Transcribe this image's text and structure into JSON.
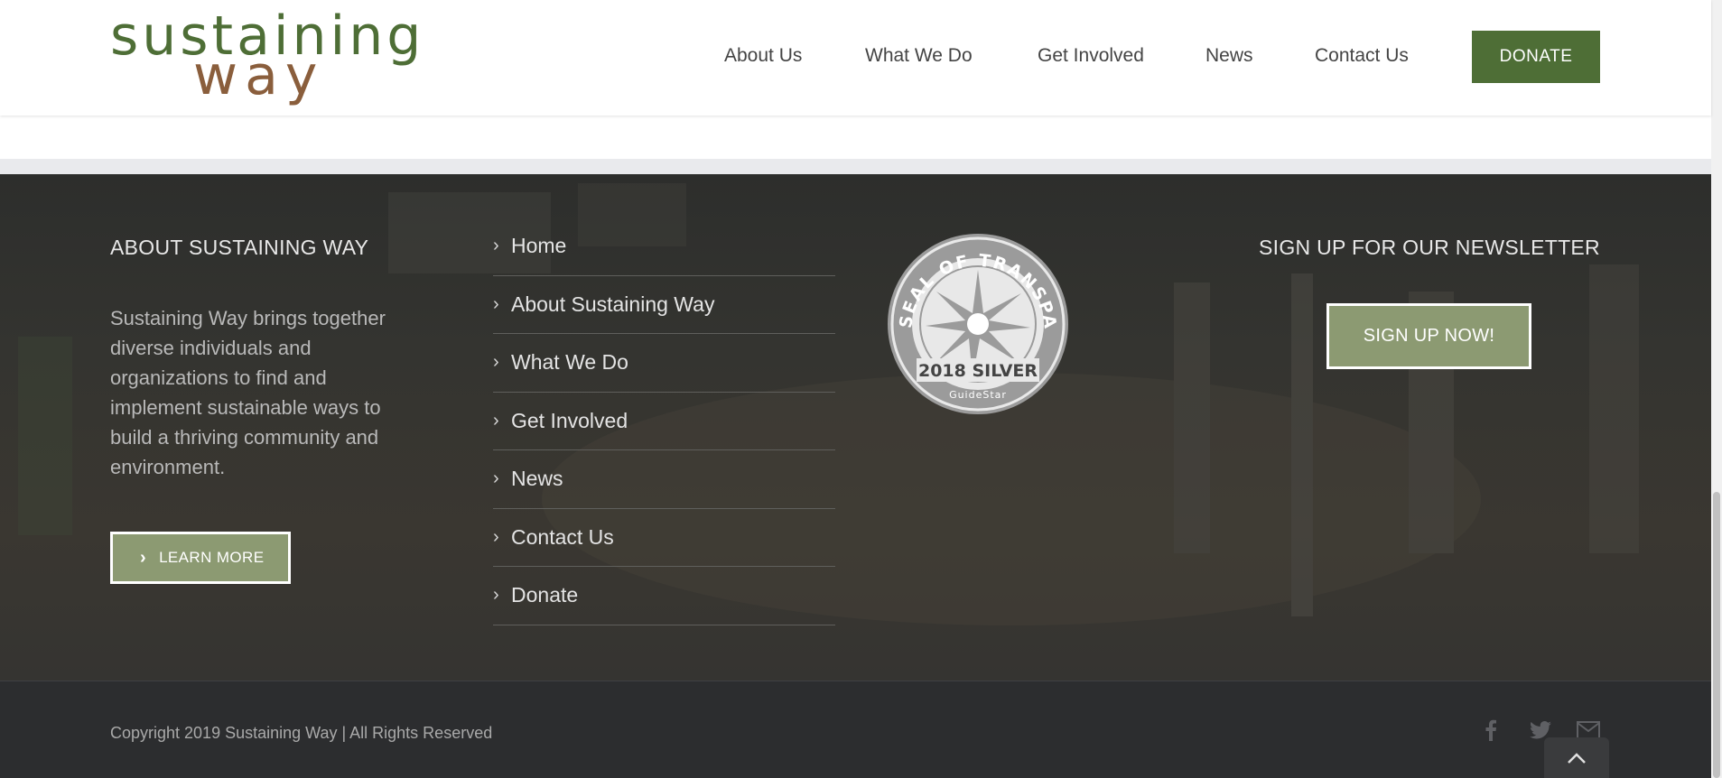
{
  "header": {
    "logo_line1": "sustaining",
    "logo_line2": "way",
    "nav": [
      "About Us",
      "What We Do",
      "Get Involved",
      "News",
      "Contact Us"
    ],
    "donate_label": "DONATE"
  },
  "footer": {
    "about_title": "ABOUT SUSTAINING WAY",
    "about_text": "Sustaining Way brings together diverse individuals and organizations to find and implement sustainable ways to build a thriving community and environment.",
    "learn_more_label": "LEARN MORE",
    "links": [
      "Home",
      "About Sustaining Way",
      "What We Do",
      "Get Involved",
      "News",
      "Contact Us",
      "Donate"
    ],
    "seal": {
      "arc_text": "SEAL OF TRANSPARENCY",
      "year_text": "2018 SILVER",
      "brand_text": "GuideStar"
    },
    "newsletter_title": "SIGN UP FOR OUR NEWSLETTER",
    "signup_label": "SIGN UP NOW!"
  },
  "bottom": {
    "copyright": "Copyright 2019 Sustaining Way | All Rights Reserved",
    "social_icons": [
      "facebook-icon",
      "twitter-icon",
      "email-icon"
    ]
  },
  "colors": {
    "brand_green": "#4e6e36",
    "brand_brown": "#8a5e3c",
    "button_sage": "#8c9a72",
    "footer_bg": "#323230",
    "bottom_bg": "#2c2d2f"
  }
}
